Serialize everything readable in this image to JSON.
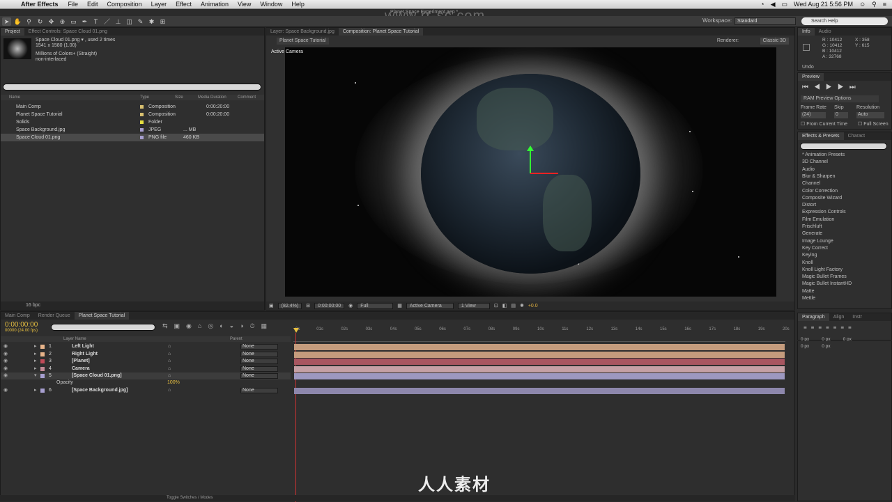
{
  "menubar": {
    "app": "After Effects",
    "items": [
      "File",
      "Edit",
      "Composition",
      "Layer",
      "Effect",
      "Animation",
      "View",
      "Window",
      "Help"
    ],
    "clock": "Wed Aug 21  5:56 PM"
  },
  "doc_title": "Planet Space Experiment.aep *",
  "watermark_url": "www.rr-sc.com",
  "workspace": {
    "label": "Workspace:",
    "value": "Standard"
  },
  "help_search": "Search Help",
  "project": {
    "tabs": [
      "Project",
      "Effect Controls: Space Cloud 01.png"
    ],
    "info_name": "Space Cloud 01.png ▾ , used 2 times",
    "info_dims": "1541 x 1580 (1.00)",
    "info_colors": "Millions of Colors+ (Straight)",
    "info_interlace": "non-interlaced",
    "columns": [
      "Name",
      "Type",
      "Size",
      "Media Duration",
      "Comment"
    ],
    "items": [
      {
        "name": "Main Comp",
        "type": "Composition",
        "size": "",
        "duration": "0:00:20:00"
      },
      {
        "name": "Planet Space Tutorial",
        "type": "Composition",
        "size": "",
        "duration": "0:00:20:00"
      },
      {
        "name": "Solids",
        "type": "Folder",
        "size": "",
        "duration": ""
      },
      {
        "name": "Space Background.jpg",
        "type": "JPEG",
        "size": "... MB",
        "duration": ""
      },
      {
        "name": "Space Cloud 01.png",
        "type": "PNG file",
        "size": "460 KB",
        "duration": ""
      }
    ],
    "bpc": "16 bpc"
  },
  "composition": {
    "tabs": [
      "Layer: Space Background.jpg",
      "Composition: Planet Space Tutorial"
    ],
    "sub_tab": "Planet Space Tutorial",
    "renderer_label": "Renderer:",
    "renderer": "Classic 3D",
    "view_label": "Active Camera",
    "footer": {
      "zoom": "(82.4%)",
      "time": "0:00:00:00",
      "res": "Full",
      "camera": "Active Camera",
      "views": "1 View",
      "exposure": "+0.0"
    }
  },
  "info_panel": {
    "tabs": [
      "Info",
      "Audio"
    ],
    "r": "R : 10412",
    "g": "G : 10412",
    "b": "B : 10412",
    "a": "A : 32768",
    "x": "X : 358",
    "y": "Y : 615",
    "undo": "Undo"
  },
  "preview": {
    "tab": "Preview",
    "options": "RAM Preview Options",
    "frame_rate_label": "Frame Rate",
    "skip_label": "Skip",
    "resolution_label": "Resolution",
    "frame_rate": "(24)",
    "skip": "0",
    "resolution": "Auto",
    "from_current": "From Current Time",
    "full_screen": "Full Screen"
  },
  "effects": {
    "tabs": [
      "Effects & Presets",
      "Charact"
    ],
    "items": [
      "* Animation Presets",
      "3D Channel",
      "Audio",
      "Blur & Sharpen",
      "Channel",
      "Color Correction",
      "Composite Wizard",
      "Distort",
      "Expression Controls",
      "Film Emulation",
      "Frischluft",
      "Generate",
      "Image Lounge",
      "Key Correct",
      "Keying",
      "Knoll",
      "Knoll Light Factory",
      "Magic Bullet Frames",
      "Magic Bullet InstantHD",
      "Matte",
      "Mettle"
    ]
  },
  "paragraph": {
    "tabs": [
      "Paragraph",
      "Align",
      "Instr"
    ],
    "values": [
      "0 px",
      "0 px",
      "0 px",
      "0 px",
      "0 px"
    ]
  },
  "timeline": {
    "tabs": [
      "Main Comp",
      "Render Queue",
      "Planet Space Tutorial"
    ],
    "timecode": "0:00:00:00",
    "fps": "00000 (24.00 fps)",
    "col_layer": "Layer Name",
    "col_parent": "Parent",
    "ruler": [
      "0s",
      "01s",
      "02s",
      "03s",
      "04s",
      "05s",
      "06s",
      "07s",
      "08s",
      "09s",
      "10s",
      "11s",
      "12s",
      "13s",
      "14s",
      "15s",
      "16s",
      "17s",
      "18s",
      "19s",
      "20s"
    ],
    "layers": [
      {
        "num": "1",
        "name": "Left Light",
        "color": "#e8b48a",
        "parent": "None",
        "track": "#c59c7d"
      },
      {
        "num": "2",
        "name": "Right Light",
        "color": "#e8b48a",
        "parent": "None",
        "track": "#c59c7d"
      },
      {
        "num": "3",
        "name": "[Planet]",
        "color": "#c04a58",
        "parent": "None",
        "track": "#a85660"
      },
      {
        "num": "4",
        "name": "Camera",
        "color": "#c38a96",
        "parent": "None",
        "track": "#c5a0a5"
      },
      {
        "num": "5",
        "name": "[Space Cloud 01.png]",
        "color": "#a79fd0",
        "parent": "None",
        "track": "#9d98c0"
      },
      {
        "num": "6",
        "name": "[Space Background.jpg]",
        "color": "#a79fd0",
        "parent": "None",
        "track": "#8d87ac"
      }
    ],
    "opacity_label": "Opacity",
    "opacity_value": "100%",
    "toggle": "Toggle Switches / Modes"
  },
  "brand_watermark": "人人素材"
}
